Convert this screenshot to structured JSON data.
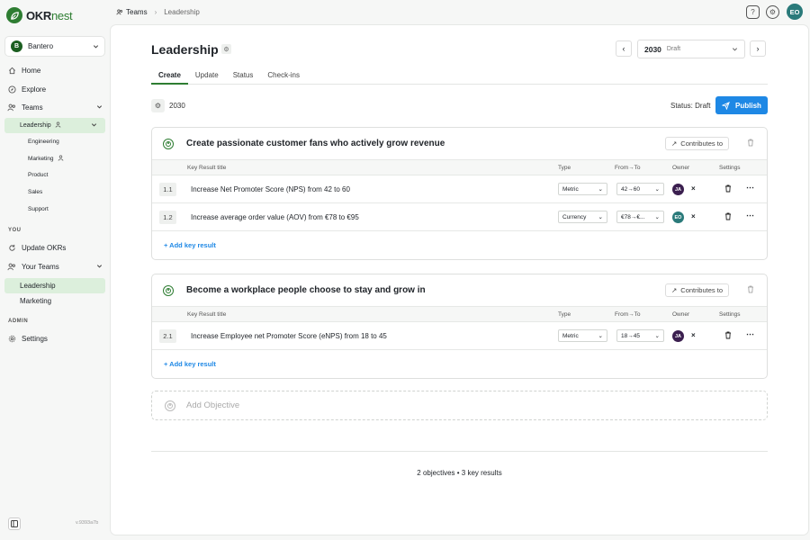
{
  "app": {
    "logo_okr": "OKR",
    "logo_nest": "nest",
    "version": "v.9393a7b"
  },
  "workspace": {
    "avatar": "B",
    "name": "Bantero"
  },
  "sidebar": {
    "nav": [
      {
        "label": "Home",
        "icon": "home-icon"
      },
      {
        "label": "Explore",
        "icon": "compass-icon"
      },
      {
        "label": "Teams",
        "icon": "users-icon"
      }
    ],
    "teams": {
      "leadership": "Leadership",
      "children": [
        "Engineering",
        "Marketing",
        "Product",
        "Sales",
        "Support"
      ]
    },
    "you_section": "YOU",
    "you_items": [
      {
        "label": "Update OKRs"
      },
      {
        "label": "Your Teams"
      }
    ],
    "your_teams": [
      "Leadership",
      "Marketing"
    ],
    "admin_section": "ADMIN",
    "settings": "Settings"
  },
  "breadcrumb": {
    "teams": "Teams",
    "separator": "›",
    "current": "Leadership"
  },
  "user": {
    "initials": "EO"
  },
  "page": {
    "title": "Leadership",
    "year": "2030",
    "year_status": "Draft",
    "tabs": [
      "Create",
      "Update",
      "Status",
      "Check-ins"
    ],
    "status_year": "2030",
    "status_text": "Status: Draft",
    "publish": "Publish",
    "add_objective": "Add Objective",
    "summary": "2 objectives • 3 key results"
  },
  "table_headers": {
    "title": "Key Result title",
    "type": "Type",
    "from_to": "From→To",
    "owner": "Owner",
    "settings": "Settings"
  },
  "objectives": [
    {
      "title": "Create passionate customer fans who actively grow revenue",
      "contributes": "Contributes to",
      "add_kr": "+ Add key result",
      "key_results": [
        {
          "num": "1.1",
          "title": "Increase Net Promoter Score (NPS) from 42 to 60",
          "type": "Metric",
          "range": "42→60",
          "owner": "JA",
          "owner_color": "#3b1f4f"
        },
        {
          "num": "1.2",
          "title": "Increase average order value (AOV) from €78 to €95",
          "type": "Currency",
          "range": "€78→€...",
          "owner": "EO",
          "owner_color": "#2a7a7a"
        }
      ]
    },
    {
      "title": "Become a workplace people choose to stay and grow in",
      "contributes": "Contributes to",
      "add_kr": "+ Add key result",
      "key_results": [
        {
          "num": "2.1",
          "title": "Increase Employee net Promoter Score (eNPS) from 18 to 45",
          "type": "Metric",
          "range": "18→45",
          "owner": "JA",
          "owner_color": "#3b1f4f"
        }
      ]
    }
  ]
}
